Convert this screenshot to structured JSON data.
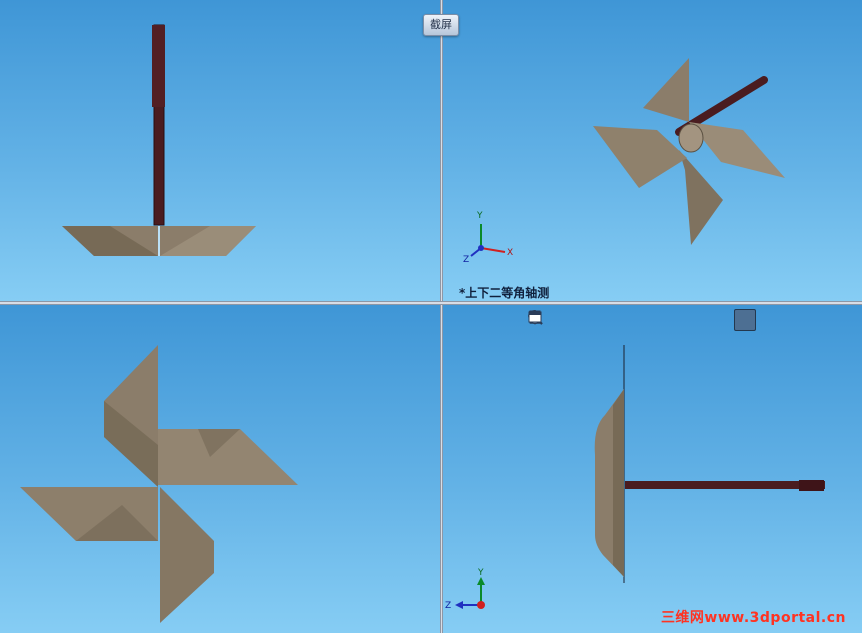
{
  "screenshot_button": {
    "label": "截屏"
  },
  "viewports": {
    "top_right": {
      "view_label": "*上下二等角轴测"
    }
  },
  "triad": {
    "x": "X",
    "y": "Y",
    "z": "Z"
  },
  "view_toolbar": {
    "icons": [
      "zoom-to-fit-icon",
      "zoom-to-area-icon",
      "rotate-view-icon",
      "pan-icon",
      "section-view-icon",
      "view-orientation-icon",
      "shaded-edges-icon",
      "shaded-icon",
      "hidden-lines-removed-icon",
      "hidden-lines-visible-icon",
      "wireframe-icon",
      "display-style-icon",
      "single-viewport-icon",
      "two-viewport-icon",
      "four-viewport-icon"
    ],
    "active_index": 9
  },
  "watermark": {
    "text": "三维网www.3dportal.cn"
  },
  "colors": {
    "viewport_top": "#3f96d6",
    "viewport_bottom": "#86cdf4",
    "blade": "#8b7d6a",
    "shaft": "#4a1c20",
    "watermark": "#ff3322"
  }
}
